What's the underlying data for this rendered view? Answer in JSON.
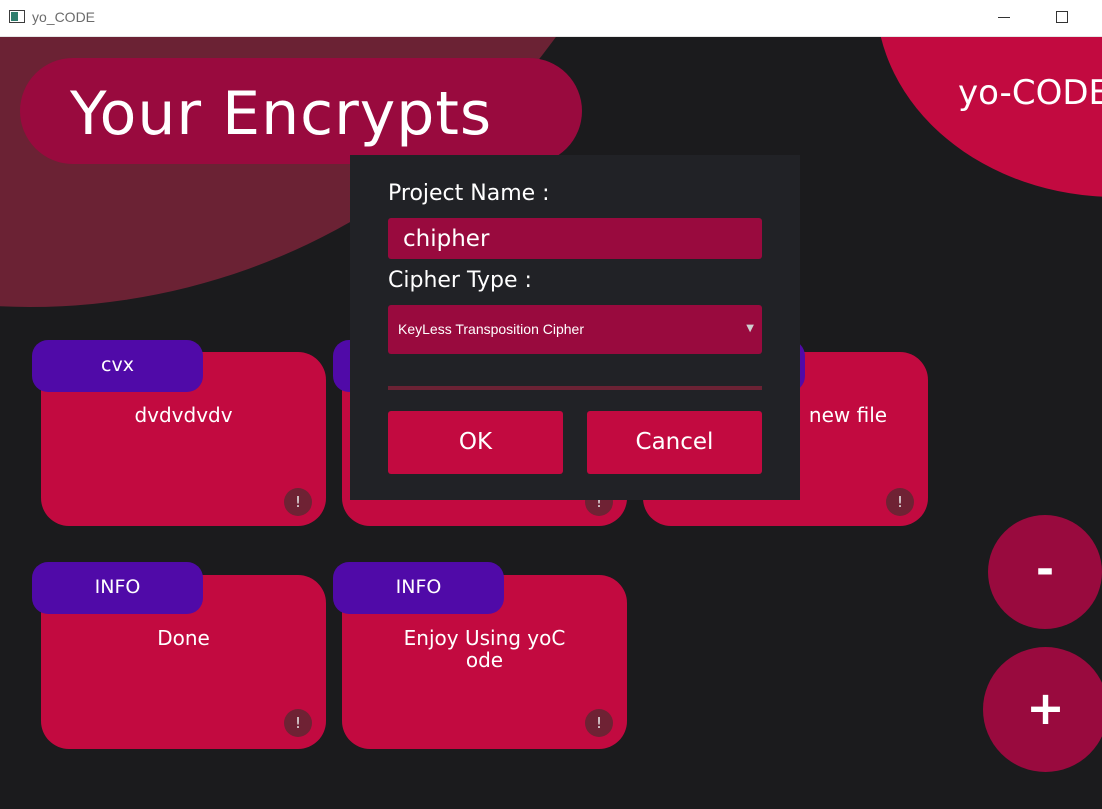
{
  "window": {
    "title": "yo_CODE",
    "icons": {
      "app": "app-icon",
      "minimize": "minimize-icon",
      "maximize": "maximize-icon"
    }
  },
  "header": {
    "title": "Your Encrypts"
  },
  "brand": {
    "label": "yo-CODE"
  },
  "cards": [
    {
      "tab": "cvx",
      "text": "dvdvdvdv",
      "badge": "!"
    },
    {
      "tab": "",
      "text": "",
      "badge": "!"
    },
    {
      "tab": "",
      "text": "new file",
      "badge": "!"
    },
    {
      "tab": "INFO",
      "text": "Done",
      "badge": "!"
    },
    {
      "tab": "INFO",
      "text": "Enjoy Using yoCode",
      "badge": "!"
    }
  ],
  "fabs": {
    "remove": "-",
    "add": "+"
  },
  "dialog": {
    "project_name_label": "Project Name :",
    "project_name_value": "chipher",
    "cipher_type_label": "Cipher Type :",
    "cipher_type_value": "KeyLess Transposition Cipher",
    "ok_label": "OK",
    "cancel_label": "Cancel"
  },
  "colors": {
    "background": "#1b1b1d",
    "accent": "#c20a40",
    "accent_dark": "#990a3e",
    "tab": "#500aa8",
    "dialog": "#212226"
  }
}
